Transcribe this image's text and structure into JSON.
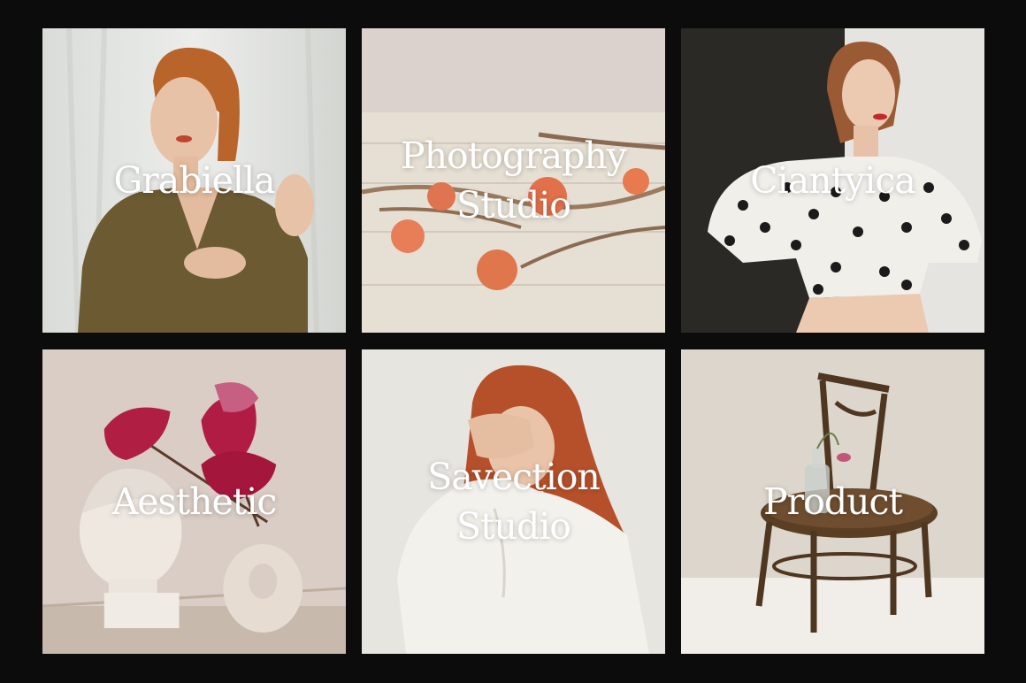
{
  "background_color": "#0c0c0d",
  "text_color": "#ffffff",
  "tiles": [
    {
      "id": "grabiella",
      "lines": [
        "Grabiella"
      ],
      "image": "woman-olive-blazer-photo"
    },
    {
      "id": "photography-studio",
      "lines": [
        "Photography",
        "Studio"
      ],
      "image": "oranges-dried-leaves-photo"
    },
    {
      "id": "ciantyica",
      "lines": [
        "Ciantyica"
      ],
      "image": "woman-polka-dot-blouse-photo"
    },
    {
      "id": "aesthetic",
      "lines": [
        "Aesthetic"
      ],
      "image": "bust-anthurium-vase-photo"
    },
    {
      "id": "savection-studio",
      "lines": [
        "Savection",
        "Studio"
      ],
      "image": "woman-hand-over-face-photo"
    },
    {
      "id": "product",
      "lines": [
        "Product"
      ],
      "image": "wooden-chair-bottle-photo"
    }
  ]
}
